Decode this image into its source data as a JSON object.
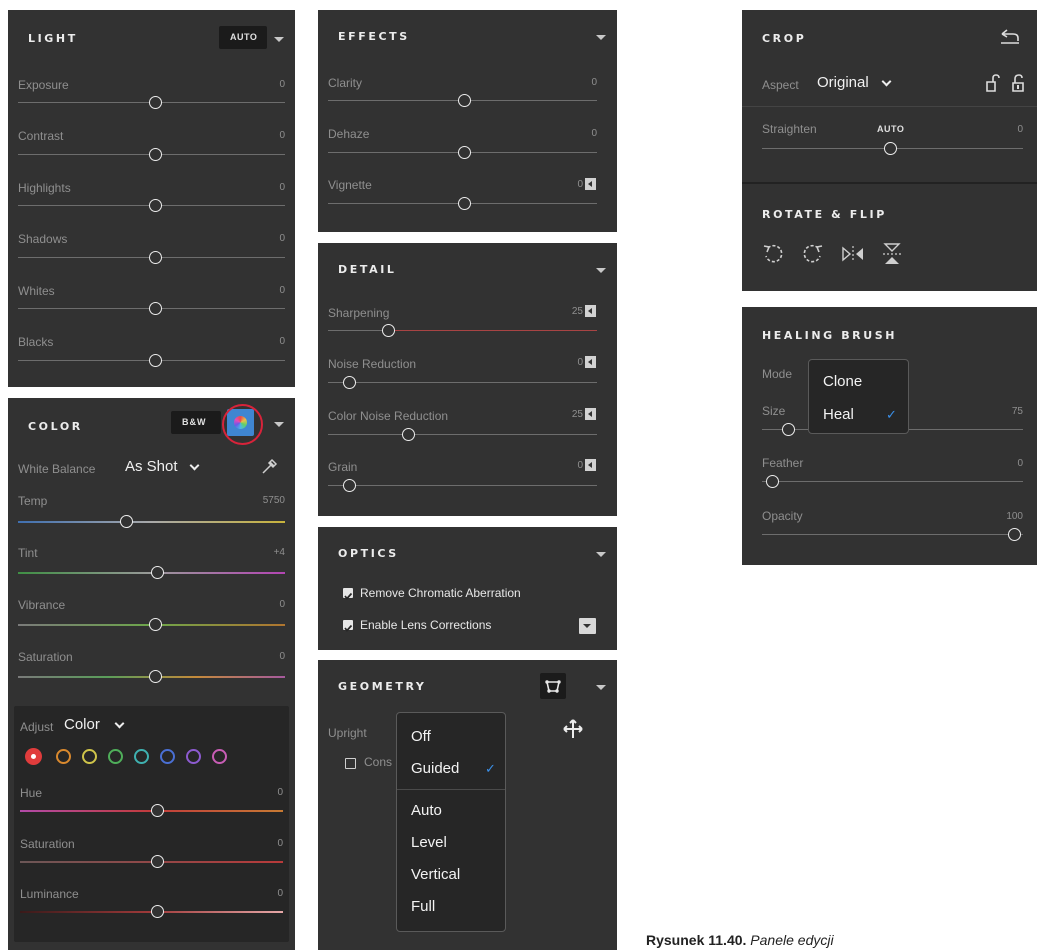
{
  "light": {
    "title": "LIGHT",
    "auto_label": "AUTO",
    "sliders": [
      {
        "label": "Exposure",
        "value": "0"
      },
      {
        "label": "Contrast",
        "value": "0"
      },
      {
        "label": "Highlights",
        "value": "0"
      },
      {
        "label": "Shadows",
        "value": "0"
      },
      {
        "label": "Whites",
        "value": "0"
      },
      {
        "label": "Blacks",
        "value": "0"
      }
    ]
  },
  "color": {
    "title": "COLOR",
    "bw_label": "B&W",
    "white_balance_label": "White Balance",
    "white_balance_value": "As Shot",
    "sliders": [
      {
        "label": "Temp",
        "value": "5750"
      },
      {
        "label": "Tint",
        "value": "+4"
      },
      {
        "label": "Vibrance",
        "value": "0"
      },
      {
        "label": "Saturation",
        "value": "0"
      }
    ],
    "mixer": {
      "adjust_label": "Adjust",
      "adjust_value": "Color",
      "swatches": [
        "red",
        "orange",
        "yellow",
        "green",
        "aqua",
        "blue",
        "purple",
        "magenta"
      ],
      "swatch_colors": [
        "#e03c3c",
        "#d9892e",
        "#cfc44a",
        "#4fae5a",
        "#3fb1b0",
        "#4a6fd3",
        "#8d5bd0",
        "#c85db5"
      ],
      "sliders": [
        {
          "label": "Hue",
          "value": "0"
        },
        {
          "label": "Saturation",
          "value": "0"
        },
        {
          "label": "Luminance",
          "value": "0"
        }
      ]
    }
  },
  "effects": {
    "title": "EFFECTS",
    "sliders": [
      {
        "label": "Clarity",
        "value": "0"
      },
      {
        "label": "Dehaze",
        "value": "0"
      },
      {
        "label": "Vignette",
        "value": "0"
      }
    ]
  },
  "detail": {
    "title": "DETAIL",
    "sliders": [
      {
        "label": "Sharpening",
        "value": "25"
      },
      {
        "label": "Noise Reduction",
        "value": "0"
      },
      {
        "label": "Color Noise Reduction",
        "value": "25"
      },
      {
        "label": "Grain",
        "value": "0"
      }
    ]
  },
  "optics": {
    "title": "OPTICS",
    "checks": [
      {
        "label": "Remove Chromatic Aberration",
        "checked": true
      },
      {
        "label": "Enable Lens Corrections",
        "checked": true
      }
    ]
  },
  "geometry": {
    "title": "GEOMETRY",
    "upright_label": "Upright",
    "constrain_label": "Cons",
    "menu": {
      "items": [
        "Off",
        "Guided",
        "Auto",
        "Level",
        "Vertical",
        "Full"
      ],
      "selected": "Guided"
    }
  },
  "crop": {
    "title": "CROP",
    "aspect_label": "Aspect",
    "aspect_value": "Original",
    "straighten_label": "Straighten",
    "straighten_auto": "AUTO",
    "straighten_value": "0",
    "rotate_title": "ROTATE & FLIP"
  },
  "healing": {
    "title": "HEALING BRUSH",
    "mode_label": "Mode",
    "menu": {
      "items": [
        "Clone",
        "Heal"
      ],
      "selected": "Heal"
    },
    "sliders": [
      {
        "label": "Size",
        "value": "75"
      },
      {
        "label": "Feather",
        "value": "0"
      },
      {
        "label": "Opacity",
        "value": "100"
      }
    ]
  },
  "caption": {
    "bold": "Rysunek 11.40.",
    "italic": "Panele edycji"
  },
  "colors": {
    "panel": "#323232",
    "accent_blue": "#3a8fe8",
    "highlight_red": "#d8233a"
  }
}
